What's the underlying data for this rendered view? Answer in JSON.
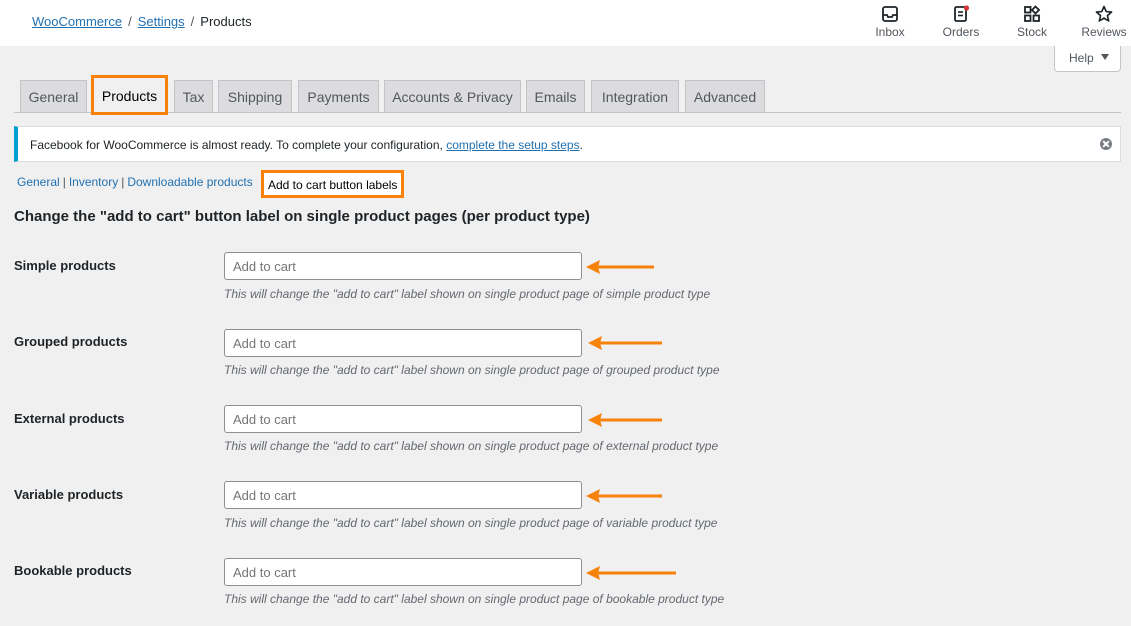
{
  "breadcrumb": {
    "link1": "WooCommerce",
    "link2": "Settings",
    "current": "Products",
    "sep": "/"
  },
  "activity": [
    {
      "label": "Inbox",
      "icon": "inbox-icon"
    },
    {
      "label": "Orders",
      "icon": "orders-icon"
    },
    {
      "label": "Stock",
      "icon": "stock-icon"
    },
    {
      "label": "Reviews",
      "icon": "reviews-icon"
    }
  ],
  "help": {
    "label": "Help"
  },
  "tabs": [
    "General",
    "Products",
    "Tax",
    "Shipping",
    "Payments",
    "Accounts & Privacy",
    "Emails",
    "Integration",
    "Advanced"
  ],
  "notice": {
    "text": "Facebook for WooCommerce is almost ready. To complete your configuration, ",
    "link": "complete the setup steps",
    "end": "."
  },
  "subnav": {
    "general": "General",
    "inventory": "Inventory",
    "downloadable": "Downloadable products",
    "current": "Add to cart button labels",
    "bar": "|"
  },
  "section_title": "Change the \"add to cart\" button label on single product pages (per product type)",
  "rows": [
    {
      "label": "Simple products",
      "placeholder": "Add to cart",
      "desc": "This will change the \"add to cart\" label shown on single product page of simple product type"
    },
    {
      "label": "Grouped products",
      "placeholder": "Add to cart",
      "desc": "This will change the \"add to cart\" label shown on single product page of grouped product type"
    },
    {
      "label": "External products",
      "placeholder": "Add to cart",
      "desc": "This will change the \"add to cart\" label shown on single product page of external product type"
    },
    {
      "label": "Variable products",
      "placeholder": "Add to cart",
      "desc": "This will change the \"add to cart\" label shown on single product page of variable product type"
    },
    {
      "label": "Bookable products",
      "placeholder": "Add to cart",
      "desc": "This will change the \"add to cart\" label shown on single product page of bookable product type"
    }
  ],
  "colors": {
    "accent": "#f7820a",
    "link": "#2271b1",
    "notice_border": "#00a0d2"
  }
}
